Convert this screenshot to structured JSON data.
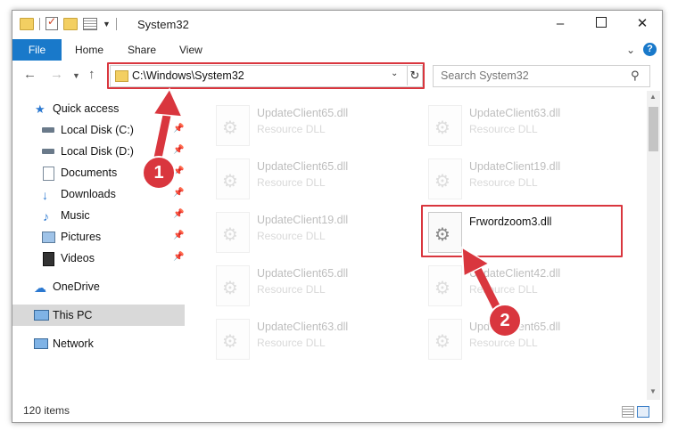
{
  "window": {
    "title": "System32",
    "controls": {
      "minimize": "–",
      "maximize": "",
      "close": "✕"
    }
  },
  "ribbon": {
    "file": "File",
    "tabs": [
      "Home",
      "Share",
      "View"
    ],
    "help": "?"
  },
  "address": {
    "path": "C:\\Windows\\System32",
    "search_placeholder": "Search System32"
  },
  "nav_pane": {
    "items": [
      {
        "label": "Quick access",
        "icon": "star-icon",
        "pinned": false
      },
      {
        "label": "Local Disk (C:)",
        "icon": "drive-icon",
        "pinned": true
      },
      {
        "label": "Local Disk (D:)",
        "icon": "drive-icon",
        "pinned": true
      },
      {
        "label": "Documents",
        "icon": "documents-icon",
        "pinned": true
      },
      {
        "label": "Downloads",
        "icon": "download-icon",
        "pinned": true
      },
      {
        "label": "Music",
        "icon": "music-icon",
        "pinned": true
      },
      {
        "label": "Pictures",
        "icon": "pictures-icon",
        "pinned": true
      },
      {
        "label": "Videos",
        "icon": "videos-icon",
        "pinned": true
      },
      {
        "label": "OneDrive",
        "icon": "cloud-icon",
        "pinned": false
      },
      {
        "label": "This PC",
        "icon": "computer-icon",
        "pinned": false,
        "selected": true
      },
      {
        "label": "Network",
        "icon": "network-icon",
        "pinned": false
      }
    ]
  },
  "files": [
    {
      "name": "UpdateClient65.dll",
      "type": "Resource DLL",
      "highlighted": false
    },
    {
      "name": "UpdateClient63.dll",
      "type": "Resource DLL",
      "highlighted": false
    },
    {
      "name": "UpdateClient65.dll",
      "type": "Resource DLL",
      "highlighted": false
    },
    {
      "name": "UpdateClient19.dll",
      "type": "Resource DLL",
      "highlighted": false
    },
    {
      "name": "UpdateClient19.dll",
      "type": "Resource DLL",
      "highlighted": false
    },
    {
      "name": "Frwordzoom3.dll",
      "type": "",
      "highlighted": true
    },
    {
      "name": "UpdateClient65.dll",
      "type": "Resource DLL",
      "highlighted": false
    },
    {
      "name": "UpdateClient42.dll",
      "type": "Resource DLL",
      "highlighted": false
    },
    {
      "name": "UpdateClient63.dll",
      "type": "Resource DLL",
      "highlighted": false
    },
    {
      "name": "UpdateClient65.dll",
      "type": "Resource DLL",
      "highlighted": false
    }
  ],
  "status": {
    "item_count": "120 items"
  },
  "callouts": {
    "step1": "1",
    "step2": "2",
    "color": "#d9363e"
  }
}
